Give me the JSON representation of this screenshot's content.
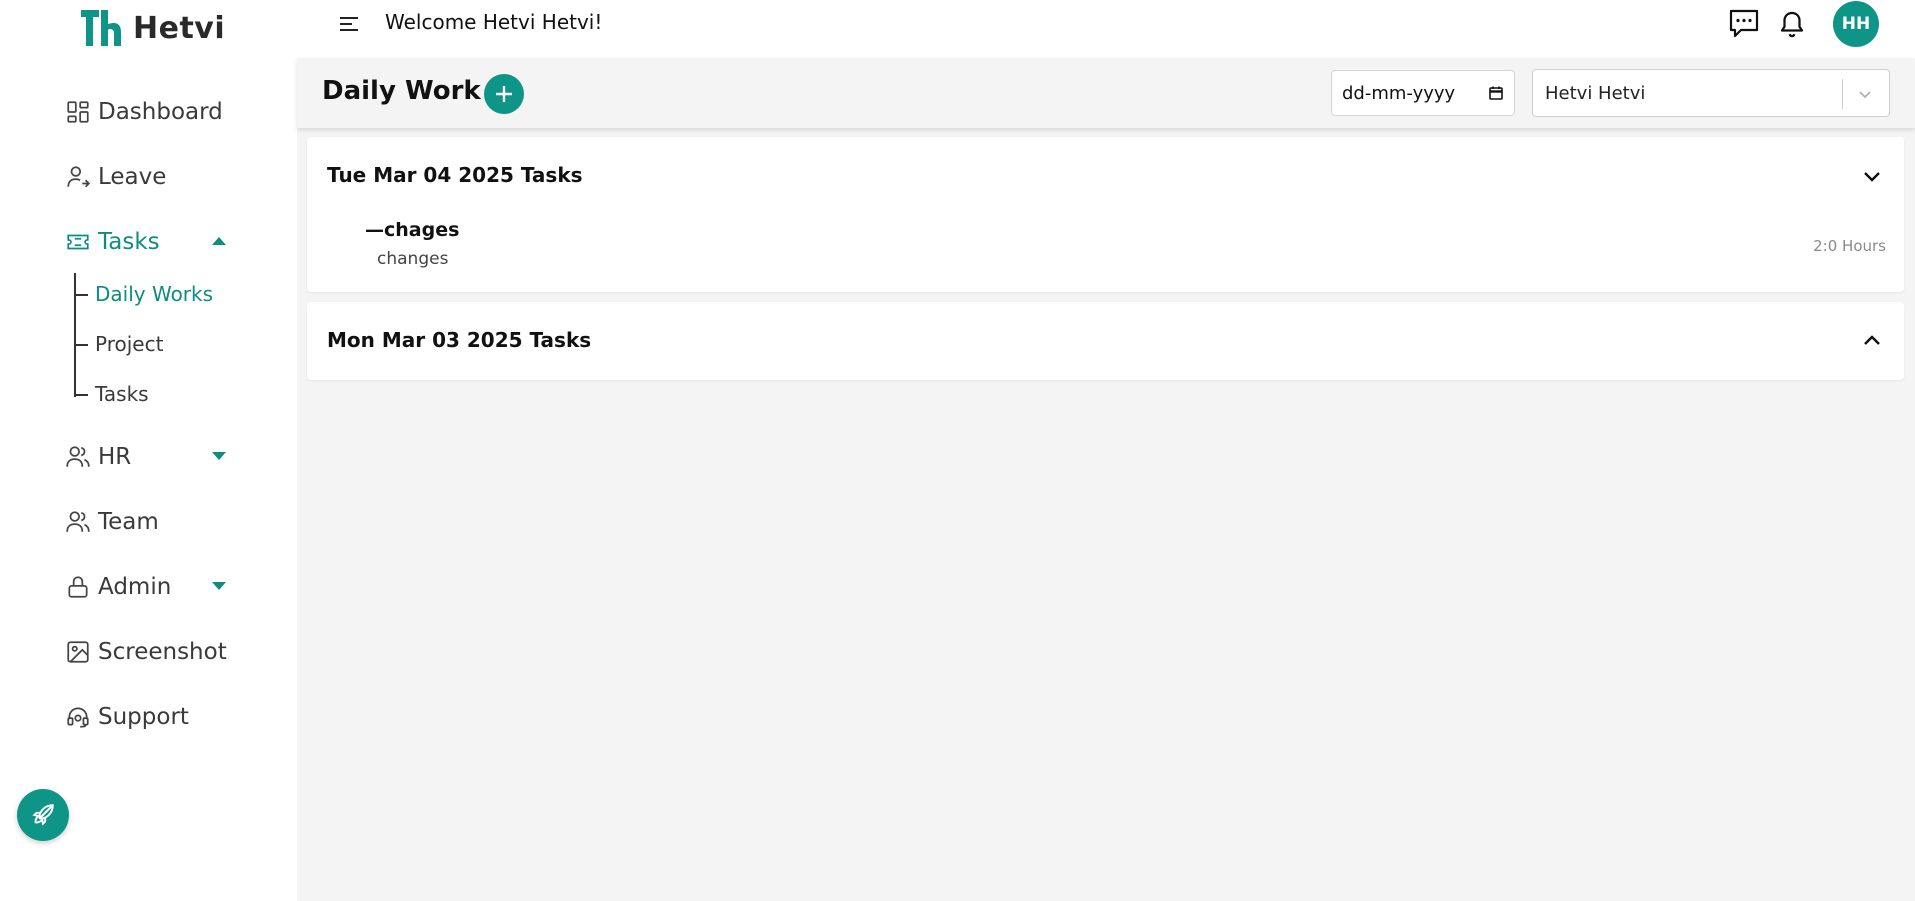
{
  "app": {
    "name": "Hetvi",
    "welcome": "Welcome Hetvi Hetvi!",
    "avatar_initials": "HH",
    "accent_color": "#0f9488"
  },
  "sidebar": {
    "items": [
      {
        "label": "Dashboard",
        "icon": "dashboard-icon"
      },
      {
        "label": "Leave",
        "icon": "user-arrow-icon"
      },
      {
        "label": "Tasks",
        "icon": "ticket-icon",
        "expanded": true
      },
      {
        "label": "HR",
        "icon": "users-icon"
      },
      {
        "label": "Team",
        "icon": "users-icon"
      },
      {
        "label": "Admin",
        "icon": "lock-icon"
      },
      {
        "label": "Screenshot",
        "icon": "image-icon"
      },
      {
        "label": "Support",
        "icon": "headset-icon"
      }
    ],
    "tasks_submenu": [
      "Daily Works",
      "Project",
      "Tasks"
    ]
  },
  "page": {
    "title": "Daily Work",
    "date_placeholder": "dd-mm-yyyy",
    "selected_user": "Hetvi Hetvi"
  },
  "task_days": [
    {
      "title": "Tue Mar 04 2025 Tasks",
      "expanded": true,
      "tasks": [
        {
          "name": "—chages",
          "description": "changes",
          "hours": "2:0 Hours"
        }
      ]
    },
    {
      "title": "Mon Mar 03 2025 Tasks",
      "expanded": false,
      "tasks": []
    }
  ]
}
